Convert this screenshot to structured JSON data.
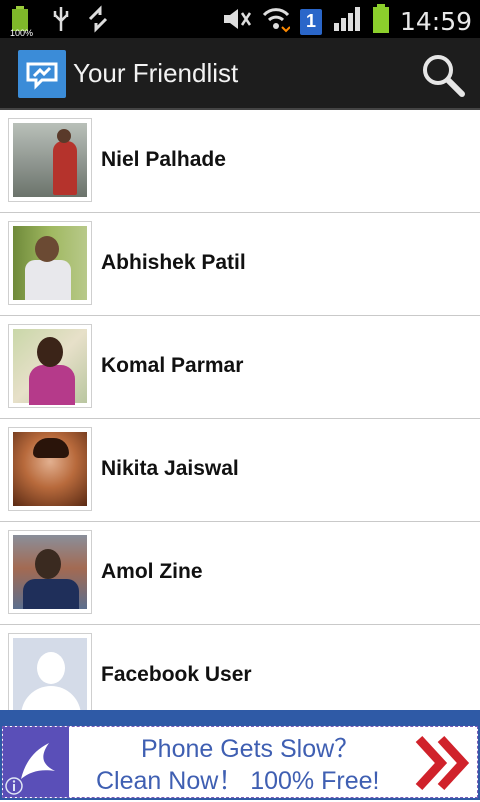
{
  "status_bar": {
    "time": "14:59",
    "battery_left_label": "100%",
    "sim_badge": "1",
    "icons": [
      "battery-icon",
      "usb-icon",
      "sync-icon",
      "mute-icon",
      "wifi-icon",
      "sim-icon",
      "signal-icon",
      "battery-full-icon"
    ]
  },
  "action_bar": {
    "title": "Your Friendlist",
    "search_icon": "search-icon",
    "app_icon": "messenger-icon"
  },
  "friends": [
    {
      "name": "Niel Palhade"
    },
    {
      "name": "Abhishek Patil"
    },
    {
      "name": "Komal Parmar"
    },
    {
      "name": "Nikita Jaiswal"
    },
    {
      "name": "Amol Zine"
    },
    {
      "name": "Facebook User"
    }
  ],
  "ad": {
    "line1": "Phone Gets Slow？",
    "line2": "Clean Now！ 100% Free!",
    "icon": "swallow-logo-icon",
    "arrow_icon": "double-chevron-right-icon",
    "info_icon": "info-icon"
  },
  "colors": {
    "actionbar": "#1d1d1d",
    "accent_blue": "#3b8cd8",
    "ad_text": "#3f5fb2",
    "ad_arrow": "#d0222b"
  }
}
